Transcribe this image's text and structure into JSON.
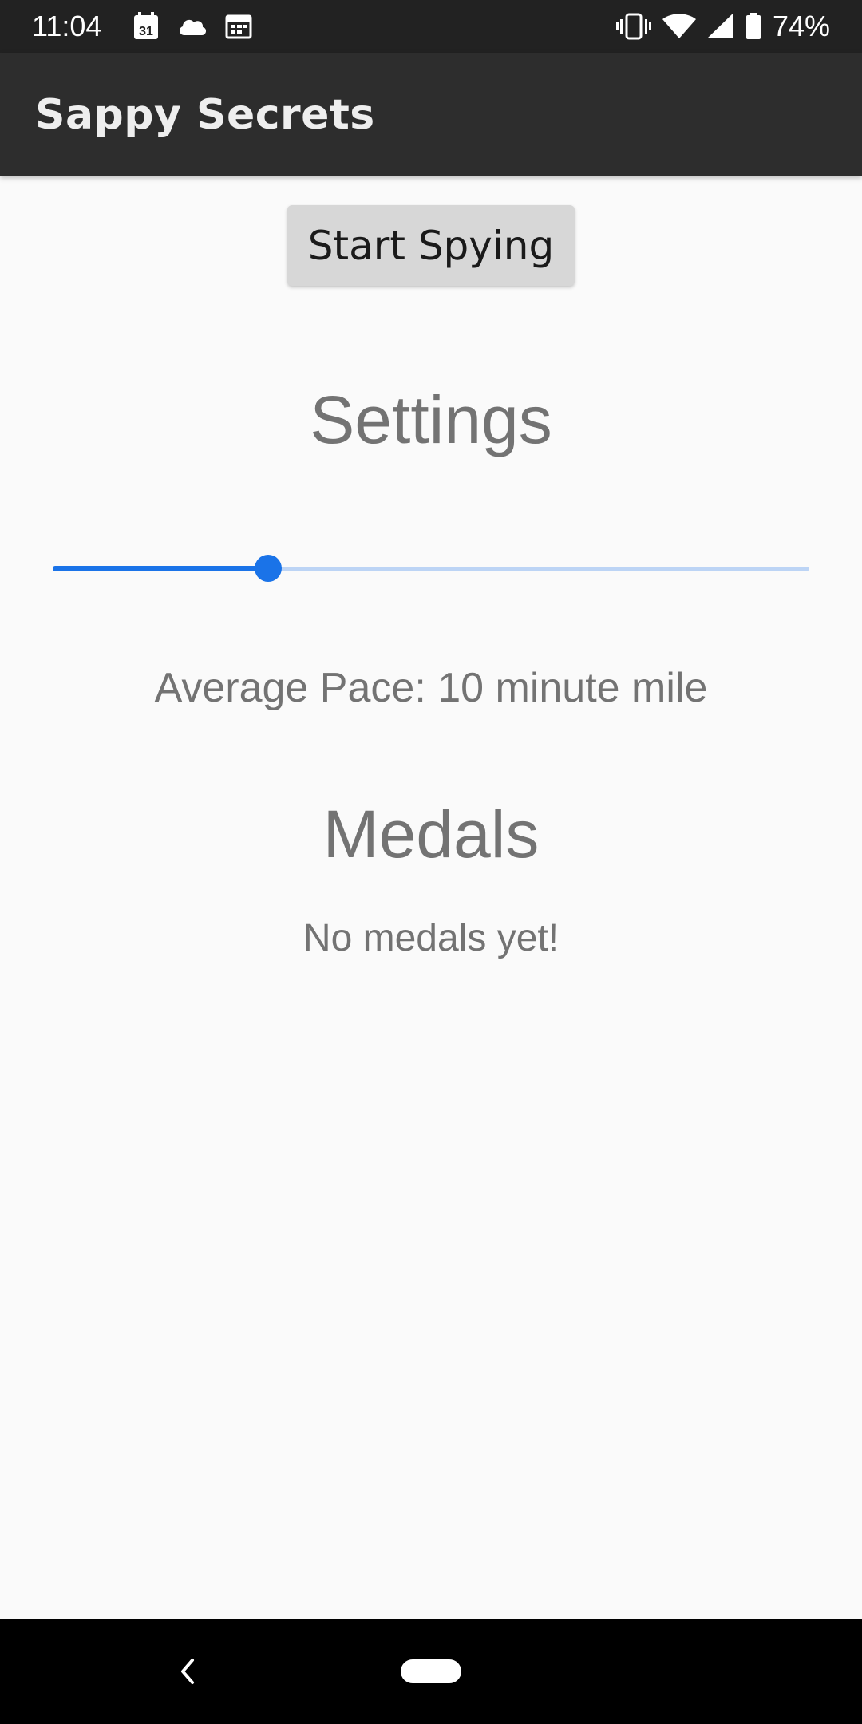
{
  "status_bar": {
    "time": "11:04",
    "battery_percent": "74%",
    "battery_level": 0.74,
    "left_icons": [
      "calendar-icon",
      "cloud-icon",
      "calendar-view-icon"
    ],
    "calendar_day": "31",
    "right_icons": [
      "vibrate-icon",
      "wifi-icon",
      "signal-icon",
      "battery-icon"
    ]
  },
  "app_bar": {
    "title": "Sappy Secrets"
  },
  "main": {
    "start_button_label": "Start Spying",
    "settings_heading": "Settings",
    "pace_slider": {
      "value_fraction": 0.285
    },
    "pace_text": "Average Pace: 10 minute mile",
    "medals_heading": "Medals",
    "medals_empty_text": "No medals yet!"
  },
  "nav_bar": {
    "icons": [
      "back-icon",
      "home-pill-icon"
    ]
  },
  "colors": {
    "accent": "#1a73e8",
    "track_inactive": "#bcd4f5",
    "app_bar": "#2d2d2d",
    "status_bar": "#222222",
    "background": "#fafafa",
    "text_secondary": "#737373"
  }
}
